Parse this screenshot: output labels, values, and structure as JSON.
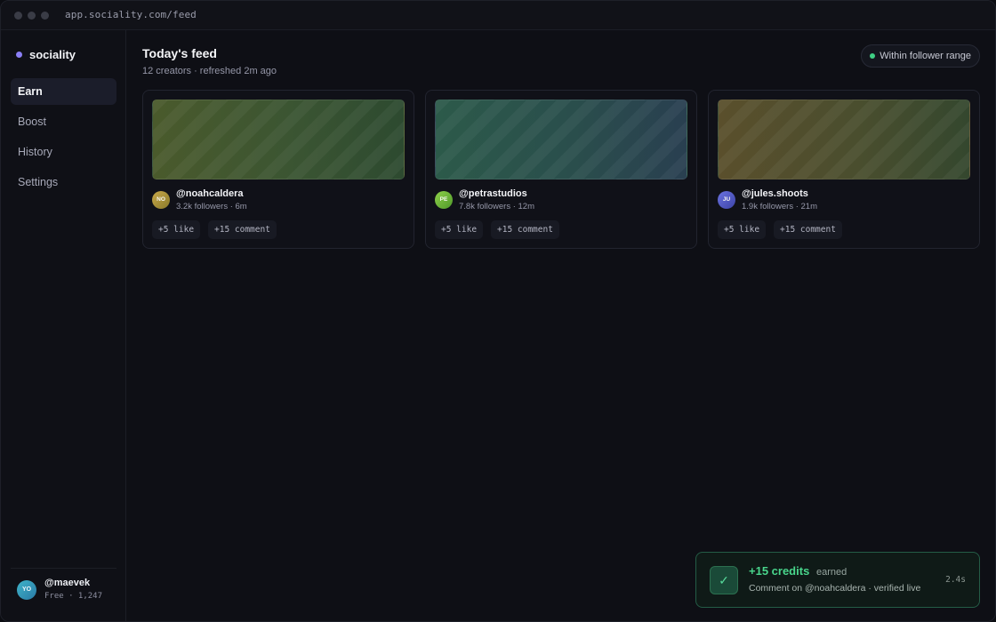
{
  "browser": {
    "url": "app.sociality.com/feed"
  },
  "sidebar": {
    "brand": "sociality",
    "items": [
      {
        "label": "Earn",
        "active": true
      },
      {
        "label": "Boost",
        "active": false
      },
      {
        "label": "History",
        "active": false
      },
      {
        "label": "Settings",
        "active": false
      }
    ],
    "user": {
      "initials": "YO",
      "handle": "@maevek",
      "plan": "Free · 1,247"
    }
  },
  "feed": {
    "title": "Today's feed",
    "subtitle": "12 creators · refreshed 2m ago",
    "range_badge": "Within follower range",
    "cards": [
      {
        "initials": "NO",
        "handle": "@noahcaldera",
        "meta": "3.2k followers · 6m",
        "like": "+5 like",
        "comment": "+15 comment"
      },
      {
        "initials": "PE",
        "handle": "@petrastudios",
        "meta": "7.8k followers · 12m",
        "like": "+5 like",
        "comment": "+15 comment"
      },
      {
        "initials": "JU",
        "handle": "@jules.shoots",
        "meta": "1.9k followers · 21m",
        "like": "+5 like",
        "comment": "+15 comment"
      }
    ]
  },
  "toast": {
    "credits": "+15 credits",
    "earned": "earned",
    "detail": "Comment on @noahcaldera · verified live",
    "time": "2.4s"
  },
  "colors": {
    "accent": "#8b7ff6",
    "success": "#49d68c",
    "background": "#0e0f15"
  },
  "icons": {
    "brand": "brand-dot-icon",
    "status": "status-dot-icon",
    "toast": "check-icon"
  }
}
